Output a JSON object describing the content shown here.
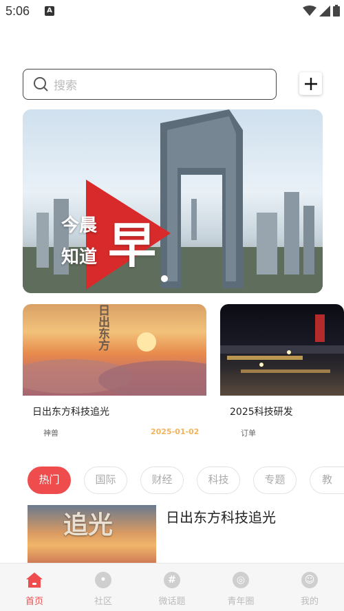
{
  "status_bar": {
    "time": "5:06",
    "notification_icon": "A"
  },
  "search": {
    "placeholder": "搜索"
  },
  "banner": {
    "line1": "今晨",
    "line2": "知道",
    "big_char": "早"
  },
  "cards": [
    {
      "title": "日出东方科技追光",
      "source": "神兽",
      "date": "2025-01-02",
      "overlay_text": "日出东方"
    },
    {
      "title": "2025科技研发",
      "source": "订单",
      "date": ""
    }
  ],
  "tabs": [
    {
      "label": "热门",
      "active": true
    },
    {
      "label": "国际",
      "active": false
    },
    {
      "label": "财经",
      "active": false
    },
    {
      "label": "科技",
      "active": false
    },
    {
      "label": "专题",
      "active": false
    },
    {
      "label": "教",
      "active": false
    }
  ],
  "news": {
    "title": "日出东方科技追光",
    "overlay_text": "追光"
  },
  "nav": [
    {
      "label": "首页",
      "icon": "home-icon",
      "active": true
    },
    {
      "label": "社区",
      "icon": "community-icon",
      "active": false
    },
    {
      "label": "微话题",
      "icon": "hashtag-icon",
      "active": false
    },
    {
      "label": "青年圈",
      "icon": "circle-icon",
      "active": false
    },
    {
      "label": "我的",
      "icon": "profile-icon",
      "active": false
    }
  ],
  "colors": {
    "accent": "#ef4d4d",
    "date": "#f5b35a"
  }
}
